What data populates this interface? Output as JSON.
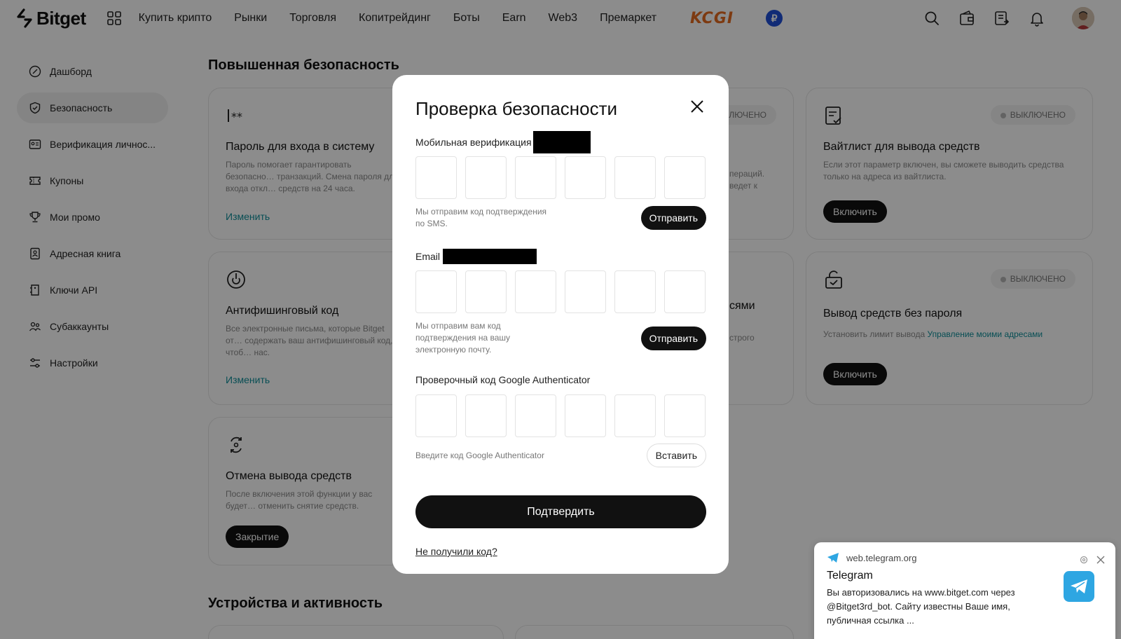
{
  "header": {
    "logo_text": "Bitget",
    "nav": [
      "Купить крипто",
      "Рынки",
      "Торговля",
      "Копитрейдинг",
      "Боты",
      "Earn",
      "Web3",
      "Премаркет"
    ],
    "promo_text": "KCGI",
    "currency_symbol": "₽",
    "icons": [
      "search-icon",
      "wallet-icon",
      "orders-icon",
      "bell-icon",
      "avatar"
    ]
  },
  "sidebar": {
    "items": [
      {
        "label": "Дашборд",
        "icon": "dashboard-icon"
      },
      {
        "label": "Безопасность",
        "icon": "shield-icon",
        "active": true
      },
      {
        "label": "Верификация личнос...",
        "icon": "id-card-icon"
      },
      {
        "label": "Купоны",
        "icon": "coupon-icon"
      },
      {
        "label": "Мои промо",
        "icon": "trophy-icon"
      },
      {
        "label": "Адресная книга",
        "icon": "address-book-icon"
      },
      {
        "label": "Ключи API",
        "icon": "api-key-icon"
      },
      {
        "label": "Субаккаунты",
        "icon": "subaccounts-icon"
      },
      {
        "label": "Настройки",
        "icon": "settings-icon"
      }
    ]
  },
  "main": {
    "section_title": "Повышенная безопасность",
    "section2_title": "Устройства и активность",
    "cards": {
      "password": {
        "title": "Пароль для входа в систему",
        "desc": "Пароль помогает гарантировать безопасно… транзакций. Смена пароля для входа откл… средств на 24 часа.",
        "link": "Изменить"
      },
      "antiphishing": {
        "title": "Антифишинговый код",
        "desc": "Все электронные письма, которые Bitget от… содержать ваш антифишинговый код, чтоб… нас.",
        "link": "Изменить"
      },
      "withdraw_cancel": {
        "title": "Отмена вывода средств",
        "desc": "После включения этой функции у вас будет… отменить снятие средств.",
        "button": "Закрытие"
      },
      "middle_top": {
        "badge": "ЛЮЧЕНО",
        "desc": "пераций. ведет к"
      },
      "middle_bottom": {
        "title": "сями",
        "desc": "строго"
      },
      "whitelist": {
        "badge": "ВЫКЛЮЧЕНО",
        "title": "Вайтлист для вывода средств",
        "desc": "Если этот параметр включен, вы сможете выводить средства только на адреса из вайтлиста.",
        "button": "Включить"
      },
      "passwordless": {
        "badge": "ВЫКЛЮЧЕНО",
        "title": "Вывод средств без пароля",
        "desc_prefix": "Установить лимит вывода",
        "desc_link": "Управление моими адресами",
        "button": "Включить"
      }
    }
  },
  "modal": {
    "title": "Проверка безопасности",
    "mobile": {
      "label": "Мобильная верификация",
      "hint": "Мы отправим код подтверждения по SMS.",
      "button": "Отправить"
    },
    "email": {
      "label": "Email",
      "hint": "Мы отправим вам код подтверждения на вашу электронную почту.",
      "button": "Отправить"
    },
    "google": {
      "label": "Проверочный код Google Authenticator",
      "hint": "Введите код Google Authenticator",
      "button": "Вставить"
    },
    "confirm": "Подтвердить",
    "no_code": "Не получили код?"
  },
  "notification": {
    "origin": "web.telegram.org",
    "title": "Telegram",
    "body": "Вы авторизовались на www.bitget.com через @Bitget3rd_bot. Сайту известны Ваше имя, публичная ссылка ..."
  }
}
